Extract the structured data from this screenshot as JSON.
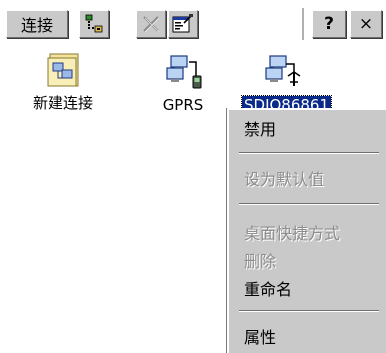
{
  "toolbar": {
    "connect_label": "连接",
    "help_label": "?",
    "close_label": "×"
  },
  "items": [
    {
      "label": "新建连接",
      "icon": "new-connection-icon",
      "selected": false
    },
    {
      "label": "GPRS",
      "icon": "network-connection-icon",
      "selected": false
    },
    {
      "label": "SDIO86861",
      "icon": "wireless-network-icon",
      "selected": true
    }
  ],
  "menu": {
    "items": [
      {
        "label": "禁用",
        "enabled": true
      },
      {
        "label": "设为默认值",
        "enabled": false
      },
      {
        "label": "桌面快捷方式",
        "enabled": false
      },
      {
        "label": "删除",
        "enabled": false
      },
      {
        "label": "重命名",
        "enabled": true
      },
      {
        "label": "属性",
        "enabled": true
      }
    ]
  },
  "colors": {
    "selection": "#0a2a8a",
    "menu_bg": "#c9c9c9",
    "disabled_text": "#8c8c8c"
  }
}
